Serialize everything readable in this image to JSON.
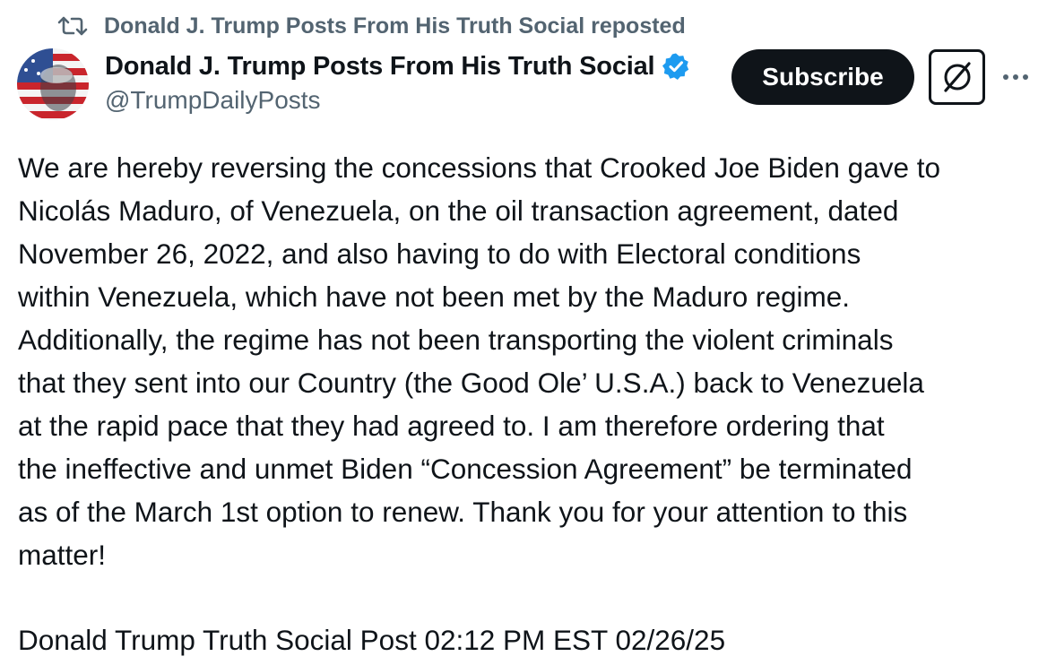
{
  "repost": {
    "icon": "repost-icon",
    "text": "Donald J. Trump Posts From His Truth Social reposted"
  },
  "author": {
    "display_name": "Donald J. Trump Posts From His Truth Social",
    "handle": "@TrumpDailyPosts",
    "verified_icon": "verified-badge-icon",
    "verified_color": "#1d9bf0"
  },
  "actions": {
    "subscribe_label": "Subscribe",
    "grok_icon": "grok-icon",
    "more_icon": "more-icon"
  },
  "post": {
    "lines": [
      "We are hereby reversing the concessions that Crooked Joe Biden gave to",
      "Nicolás Maduro, of Venezuela, on the oil transaction agreement, dated",
      "November 26, 2022, and also having to do with Electoral conditions",
      "within Venezuela, which have not been met by the Maduro regime.",
      "Additionally, the regime has not been transporting the violent criminals",
      "that they sent into our Country (the Good Ole’ U.S.A.) back to Venezuela",
      "at the rapid pace that they had agreed to. I am therefore ordering that",
      "the ineffective and unmet Biden “Concession Agreement” be terminated",
      "as of the March 1st option to renew. Thank you for your attention to this",
      "matter!"
    ],
    "footer": "Donald Trump Truth Social Post 02:12 PM EST 02/26/25"
  },
  "colors": {
    "text": "#0f1419",
    "muted": "#536471",
    "button_bg": "#0f1419",
    "button_text": "#ffffff"
  }
}
